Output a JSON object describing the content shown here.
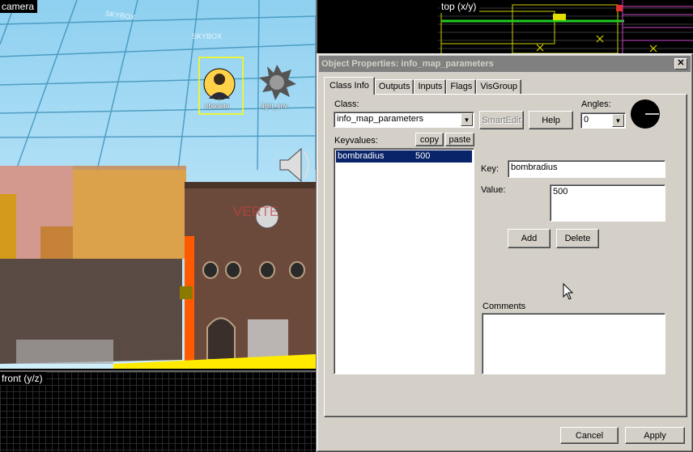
{
  "viewports": {
    "camera": "camera",
    "top": "top (x/y)",
    "front": "front (y/z)"
  },
  "scene": {
    "entity_labels": [
      "obsolete",
      "light_env"
    ],
    "sky_text": "SKYBOX",
    "wall_text": "VERTE"
  },
  "dialog": {
    "title": "Object Properties: info_map_parameters",
    "close_glyph": "✕",
    "tabs": [
      "Class Info",
      "Outputs",
      "Inputs",
      "Flags",
      "VisGroup"
    ],
    "active_tab": "Class Info",
    "class_label": "Class:",
    "class_value": "info_map_parameters",
    "smartedit_label": "SmartEdit",
    "help_label": "Help",
    "angles_label": "Angles:",
    "angles_value": "0",
    "keyvalues_label": "Keyvalues:",
    "copy_label": "copy",
    "paste_label": "paste",
    "keyvalues": [
      {
        "key": "bombradius",
        "value": "500"
      }
    ],
    "key_label": "Key:",
    "key_value": "bombradius",
    "value_label": "Value:",
    "value_value": "500",
    "add_label": "Add",
    "delete_label": "Delete",
    "comments_label": "Comments",
    "comments_value": "",
    "cancel_label": "Cancel",
    "apply_label": "Apply"
  },
  "colors": {
    "dialog_face": "#d4d0c8",
    "title_inactive": "#808080",
    "selection": "#0a246a",
    "sky": "#a8dcf5",
    "brick": "#6b4a3c"
  }
}
